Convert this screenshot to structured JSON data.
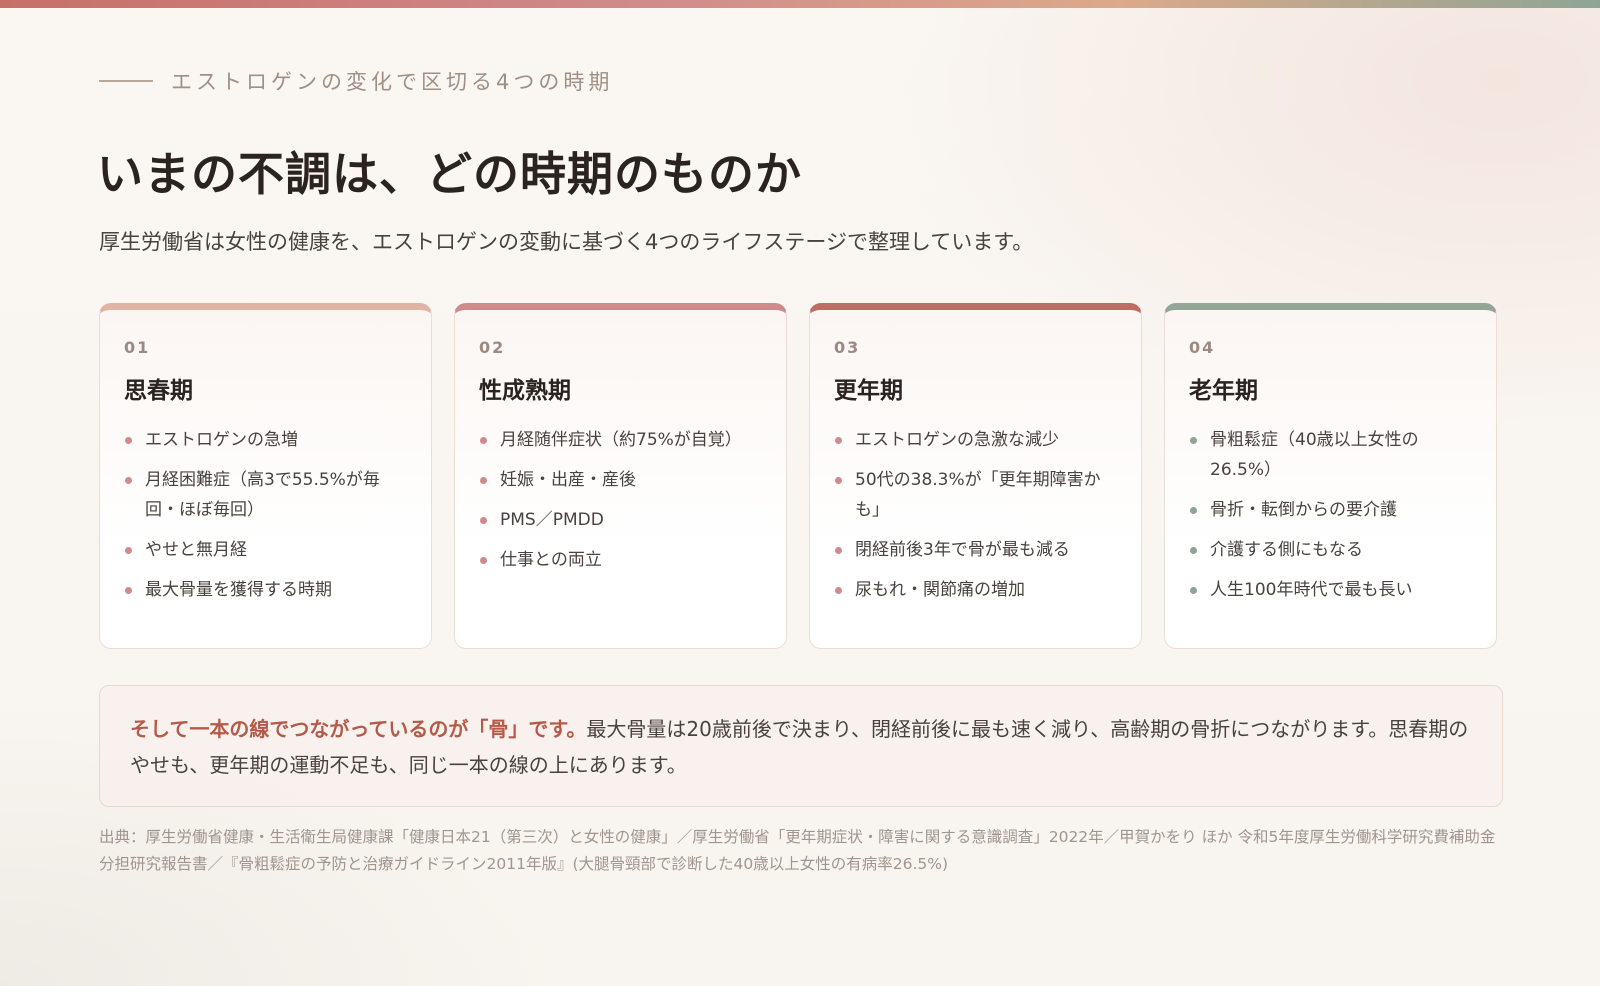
{
  "colors": {
    "accent_red": "#b55a48",
    "card1": "#dfb4a4",
    "card2": "#cf8a8c",
    "card3": "#bc6e64",
    "card4": "#93a594",
    "dot_pink": "#d08a8c",
    "dot_green": "#8ea595"
  },
  "header": {
    "eyebrow": "エストロゲンの変化で区切る4つの時期",
    "title": "いまの不調は、どの時期のものか",
    "lead": "厚生労働省は女性の健康を、エストロゲンの変動に基づく4つのライフステージで整理しています。"
  },
  "cards": [
    {
      "num": "01",
      "title": "思春期",
      "items": [
        "エストロゲンの急増",
        "月経困難症（高3で55.5%が毎回・ほぼ毎回）",
        "やせと無月経",
        "最大骨量を獲得する時期"
      ]
    },
    {
      "num": "02",
      "title": "性成熟期",
      "items": [
        "月経随伴症状（約75%が自覚）",
        "妊娠・出産・産後",
        "PMS／PMDD",
        "仕事との両立"
      ]
    },
    {
      "num": "03",
      "title": "更年期",
      "items": [
        "エストロゲンの急激な減少",
        "50代の38.3%が「更年期障害かも」",
        "閉経前後3年で骨が最も減る",
        "尿もれ・関節痛の増加"
      ]
    },
    {
      "num": "04",
      "title": "老年期",
      "items": [
        "骨粗鬆症（40歳以上女性の26.5%）",
        "骨折・転倒からの要介護",
        "介護する側にもなる",
        "人生100年時代で最も長い"
      ]
    }
  ],
  "note": {
    "strong": "そして一本の線でつながっているのが「骨」です。",
    "body": "最大骨量は20歳前後で決まり、閉経前後に最も速く減り、高齢期の骨折につながります。思春期のやせも、更年期の運動不足も、同じ一本の線の上にあります。"
  },
  "source": "出典：厚生労働省健康・生活衛生局健康課「健康日本21（第三次）と女性の健康」／厚生労働省「更年期症状・障害に関する意識調査」2022年／甲賀かをり ほか 令和5年度厚生労働科学研究費補助金 分担研究報告書／『骨粗鬆症の予防と治療ガイドライン2011年版』(大腿骨頸部で診断した40歳以上女性の有病率26.5%)"
}
